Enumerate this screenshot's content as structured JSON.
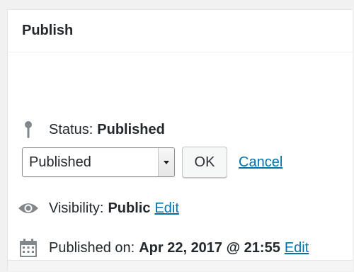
{
  "panel": {
    "title": "Publish"
  },
  "status": {
    "label": "Status:",
    "value": "Published",
    "icon": "pin-icon"
  },
  "status_select": {
    "selected": "Published"
  },
  "actions": {
    "ok_label": "OK",
    "cancel_label": "Cancel"
  },
  "visibility": {
    "label": "Visibility:",
    "value": "Public",
    "edit_label": "Edit",
    "icon": "eye-icon"
  },
  "published_on": {
    "label": "Published on:",
    "value": "Apr 22, 2017 @ 21:55",
    "edit_label": "Edit",
    "icon": "calendar-icon"
  },
  "colors": {
    "link": "#0073aa",
    "text": "#23282d",
    "icon": "#82878c"
  }
}
